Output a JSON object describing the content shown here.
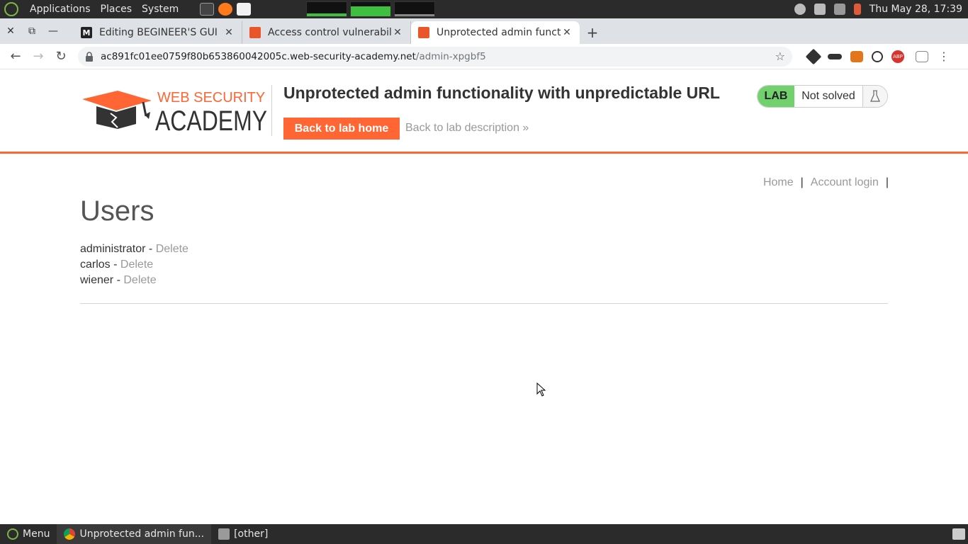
{
  "os": {
    "menu": [
      "Applications",
      "Places",
      "System"
    ],
    "clock": "Thu May 28, 17:39",
    "bottom_menu": "Menu",
    "taskbar": [
      "Unprotected admin fun...",
      "[other]"
    ]
  },
  "browser": {
    "tabs": [
      {
        "title": "Editing BEGINEER'S GUI",
        "favicon": "medium-icon"
      },
      {
        "title": "Access control vulnerabili",
        "favicon": "portswigger-icon"
      },
      {
        "title": "Unprotected admin functi",
        "favicon": "portswigger-icon",
        "active": true
      }
    ],
    "url_host": "ac891fc01ee0759f80b653860042005c.web-security-academy.net",
    "url_path": "/admin-xpgbf5",
    "extensions": [
      "extension-cube-icon",
      "mask-icon",
      "fox-icon",
      "b-icon",
      "abp-icon",
      "translate-icon"
    ]
  },
  "page": {
    "logo_top": "WEB SECURITY",
    "logo_bottom": "ACADEMY",
    "lab_title": "Unprotected admin functionality with unpredictable URL",
    "back_home": "Back to lab home",
    "back_desc": "Back to lab description",
    "lab_badge": "LAB",
    "lab_state": "Not solved",
    "nav": {
      "home": "Home",
      "separator": "|",
      "account": "Account login"
    },
    "heading": "Users",
    "users": [
      {
        "name": "administrator",
        "sep": " - ",
        "action": "Delete"
      },
      {
        "name": "carlos",
        "sep": " - ",
        "action": "Delete"
      },
      {
        "name": "wiener",
        "sep": " - ",
        "action": "Delete"
      }
    ]
  },
  "colors": {
    "accent": "#ff6633",
    "lab_green": "#70d16d",
    "link_grey": "#999999"
  }
}
